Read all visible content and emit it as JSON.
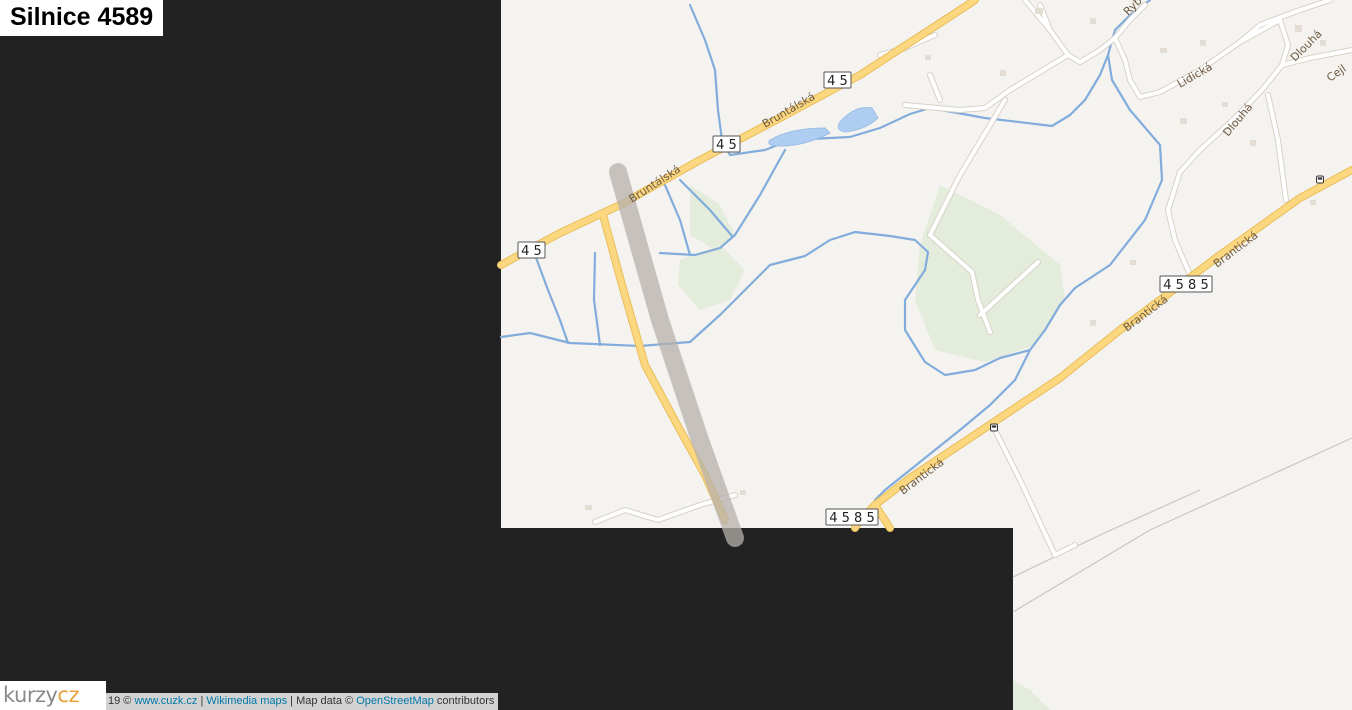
{
  "header": {
    "title": "Silnice 4589"
  },
  "logo": {
    "part1": "kurzy",
    "part2": "cz"
  },
  "attribution": {
    "copyright_prefix": "19 ©",
    "cuzk_link": "www.cuzk.cz",
    "sep1": "|",
    "wikimedia_link": "Wikimedia maps",
    "sep2": "| Map data ©",
    "osm_link": "OpenStreetMap",
    "suffix": "contributors"
  },
  "map": {
    "street_labels": {
      "bruntalska_1": "Bruntálská",
      "bruntalska_2": "Bruntálská",
      "branticka_1": "Brantická",
      "branticka_2": "Brantická",
      "branticka_3": "Brantická",
      "lidicka": "Lidická",
      "dlouha_1": "Dlouhá",
      "dlouha_2": "Dlouhá",
      "cejl": "Cejl",
      "ryb": "Ryb"
    },
    "route_shields": {
      "r45_top": "4 5",
      "r45_mid": "4 5",
      "r45_left": "4 5",
      "r4585_right": "4 5 8 5",
      "r4585_bottom": "4 5 8 5"
    },
    "colors": {
      "background": "#f5f3ef",
      "major_road": "#fbd77f",
      "major_road_casing": "#e9bd5b",
      "minor_road": "#ffffff",
      "minor_road_casing": "#d7d2c8",
      "water": "#82acdc",
      "water_fill": "#aecdf0",
      "green": "#e4ecdc",
      "highlight_route": "#b5b0ab",
      "mask": "#222222"
    },
    "icons": [
      "bus-stop-icon",
      "bus-stop-icon"
    ]
  }
}
